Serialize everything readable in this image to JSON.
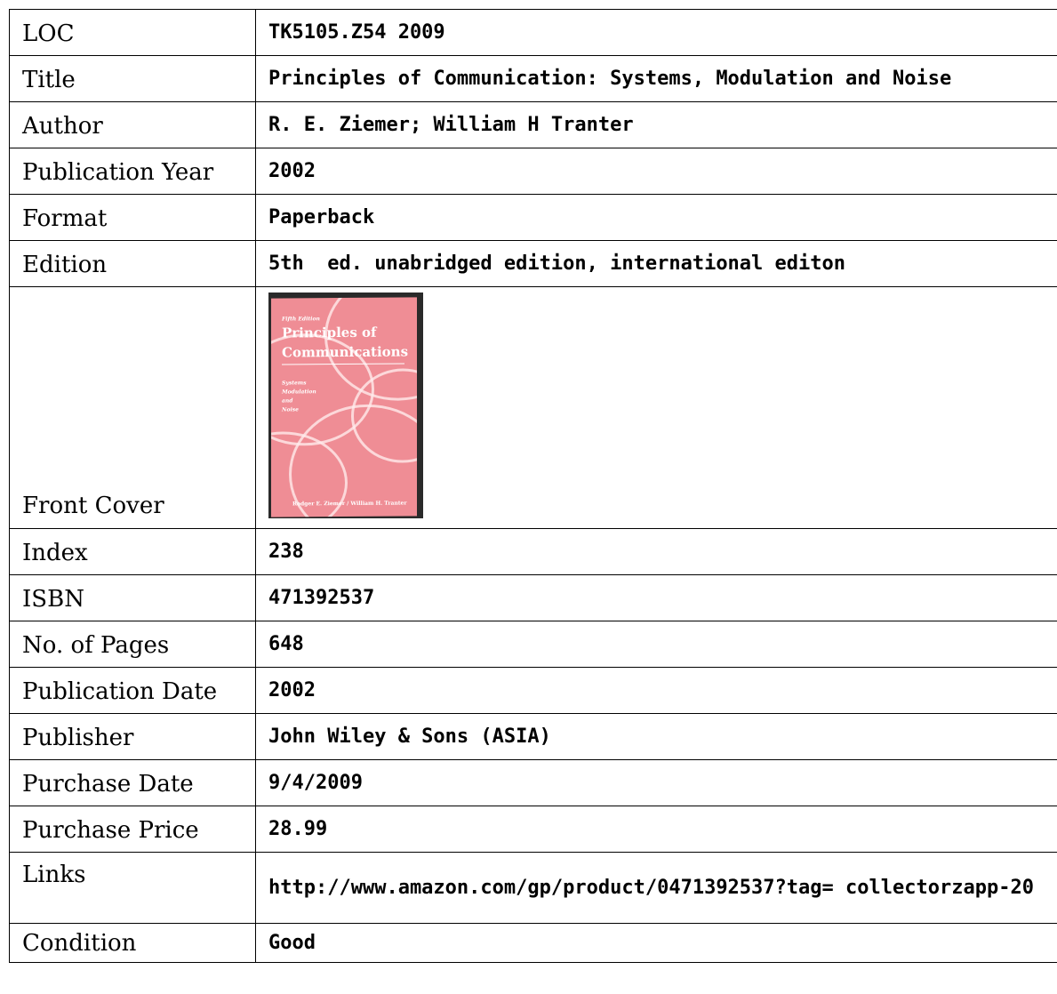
{
  "record": {
    "loc": {
      "label": "LOC",
      "value": "TK5105.Z54 2009"
    },
    "title": {
      "label": "Title",
      "value": "Principles of Communication: Systems, Modulation and Noise"
    },
    "author": {
      "label": "Author",
      "value": "R. E. Ziemer; William H Tranter"
    },
    "publication_year": {
      "label": "Publication Year",
      "value": "2002"
    },
    "format": {
      "label": "Format",
      "value": "Paperback"
    },
    "edition": {
      "label": "Edition",
      "value": "5th  ed. unabridged edition, international editon"
    },
    "front_cover": {
      "label": "Front Cover",
      "cover": {
        "edition_line": "Fifth Edition",
        "title_line1": "Principles of",
        "title_line2": "Communications",
        "subtitle_lines": [
          "Systems",
          "Modulation",
          "and",
          "Noise"
        ],
        "authors": "Rodger E. Ziemer / William H. Tranter",
        "color": "#ef8d95"
      }
    },
    "index": {
      "label": "Index",
      "value": "238"
    },
    "isbn": {
      "label": "ISBN",
      "value": "471392537"
    },
    "pages": {
      "label": "No. of Pages",
      "value": "648"
    },
    "publication_date": {
      "label": "Publication Date",
      "value": "2002"
    },
    "publisher": {
      "label": "Publisher",
      "value": "John Wiley & Sons (ASIA)"
    },
    "purchase_date": {
      "label": "Purchase Date",
      "value": "9/4/2009"
    },
    "purchase_price": {
      "label": "Purchase Price",
      "value": "28.99"
    },
    "links": {
      "label": "Links",
      "value": "http://www.amazon.com/gp/product/0471392537?tag= collectorzapp-20"
    },
    "condition": {
      "label": "Condition",
      "value": "Good"
    }
  }
}
